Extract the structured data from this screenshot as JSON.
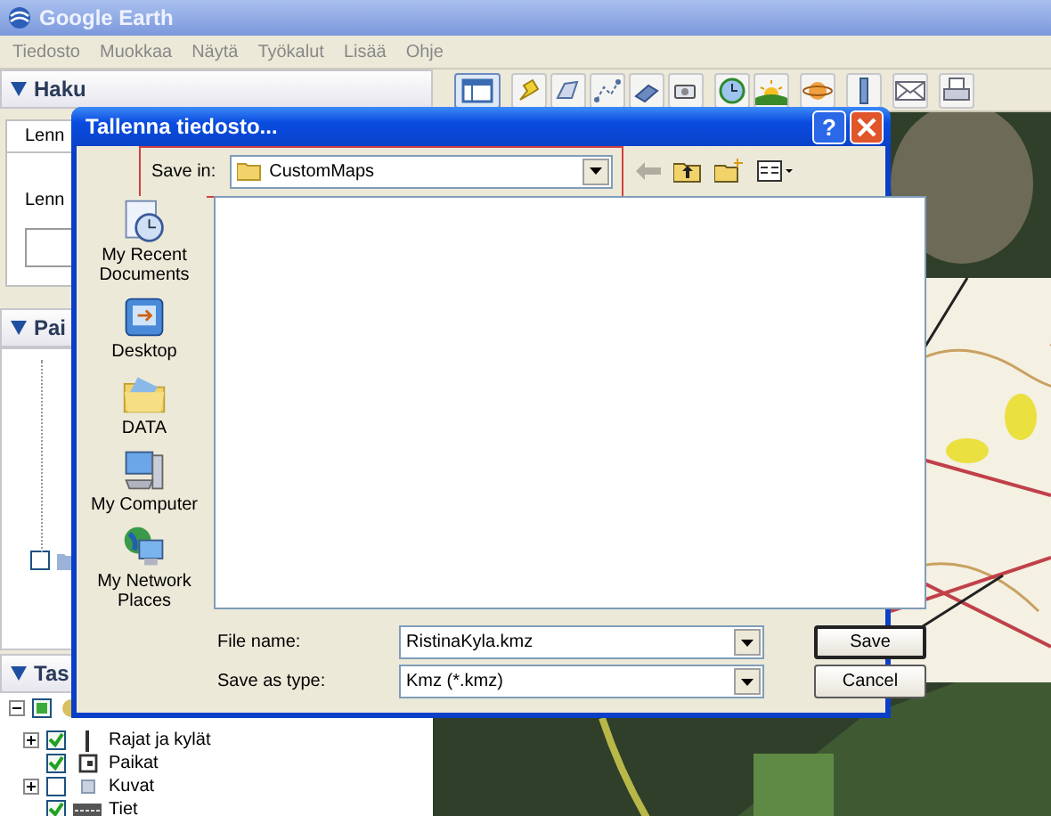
{
  "window": {
    "title": "Google Earth"
  },
  "menu": [
    "Tiedosto",
    "Muokkaa",
    "Näytä",
    "Työkalut",
    "Lisää",
    "Ohje"
  ],
  "search_panel": {
    "title": "Haku",
    "tab": "Lenn",
    "label": "Lenn"
  },
  "places_panel": {
    "title": "Pai",
    "items": [
      {
        "checked": false
      }
    ]
  },
  "layers_panel": {
    "title": "Tas",
    "items": [
      {
        "checked": true,
        "partial": true,
        "expanded": true,
        "kind": "earth",
        "children": [
          {
            "label": "Rajat ja kylät",
            "checked": true,
            "expanded": false,
            "kind": "borders"
          },
          {
            "label": "Paikat",
            "checked": true,
            "kind": "places"
          },
          {
            "label": "Kuvat",
            "checked": false,
            "expanded": false,
            "kind": "photos"
          },
          {
            "label": "Tiet",
            "checked": true,
            "kind": "roads"
          }
        ]
      }
    ]
  },
  "dialog": {
    "title": "Tallenna tiedosto...",
    "help_button": "?",
    "save_in": {
      "label": "Save in:",
      "value": "CustomMaps",
      "highlighted": true
    },
    "places": [
      {
        "label": "My Recent Documents",
        "kind": "recent"
      },
      {
        "label": "Desktop",
        "kind": "desktop"
      },
      {
        "label": "DATA",
        "kind": "folder"
      },
      {
        "label": "My Computer",
        "kind": "computer"
      },
      {
        "label": "My Network Places",
        "kind": "network"
      }
    ],
    "file_name": {
      "label": "File name:",
      "value": "RistinaKyla.kmz"
    },
    "save_as_type": {
      "label": "Save as type:",
      "value": "Kmz (*.kmz)"
    },
    "buttons": [
      {
        "label": "Save",
        "default": true
      },
      {
        "label": "Cancel",
        "default": false
      }
    ]
  }
}
